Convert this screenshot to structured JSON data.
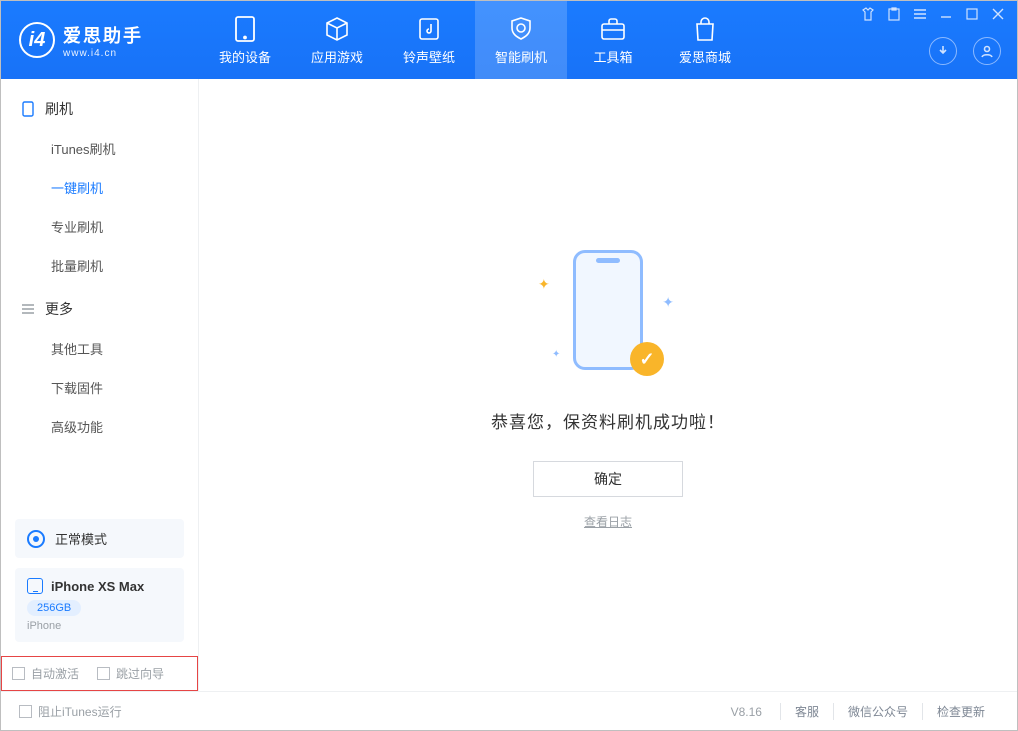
{
  "header": {
    "logo_cn": "爱思助手",
    "logo_en": "www.i4.cn",
    "tabs": [
      {
        "label": "我的设备",
        "icon": "device-icon"
      },
      {
        "label": "应用游戏",
        "icon": "cube-icon"
      },
      {
        "label": "铃声壁纸",
        "icon": "music-icon"
      },
      {
        "label": "智能刷机",
        "icon": "shield-icon"
      },
      {
        "label": "工具箱",
        "icon": "toolbox-icon"
      },
      {
        "label": "爱思商城",
        "icon": "bag-icon"
      }
    ],
    "active_tab_index": 3
  },
  "sidebar": {
    "sections": [
      {
        "title": "刷机",
        "items": [
          "iTunes刷机",
          "一键刷机",
          "专业刷机",
          "批量刷机"
        ],
        "active_index": 1
      },
      {
        "title": "更多",
        "items": [
          "其他工具",
          "下载固件",
          "高级功能"
        ]
      }
    ],
    "mode_label": "正常模式",
    "device": {
      "name": "iPhone XS Max",
      "storage": "256GB",
      "type": "iPhone"
    },
    "checkbox1": "自动激活",
    "checkbox2": "跳过向导"
  },
  "main": {
    "success_message": "恭喜您，保资料刷机成功啦！",
    "ok_button": "确定",
    "view_log": "查看日志"
  },
  "footer": {
    "stop_itunes": "阻止iTunes运行",
    "version": "V8.16",
    "links": [
      "客服",
      "微信公众号",
      "检查更新"
    ]
  }
}
